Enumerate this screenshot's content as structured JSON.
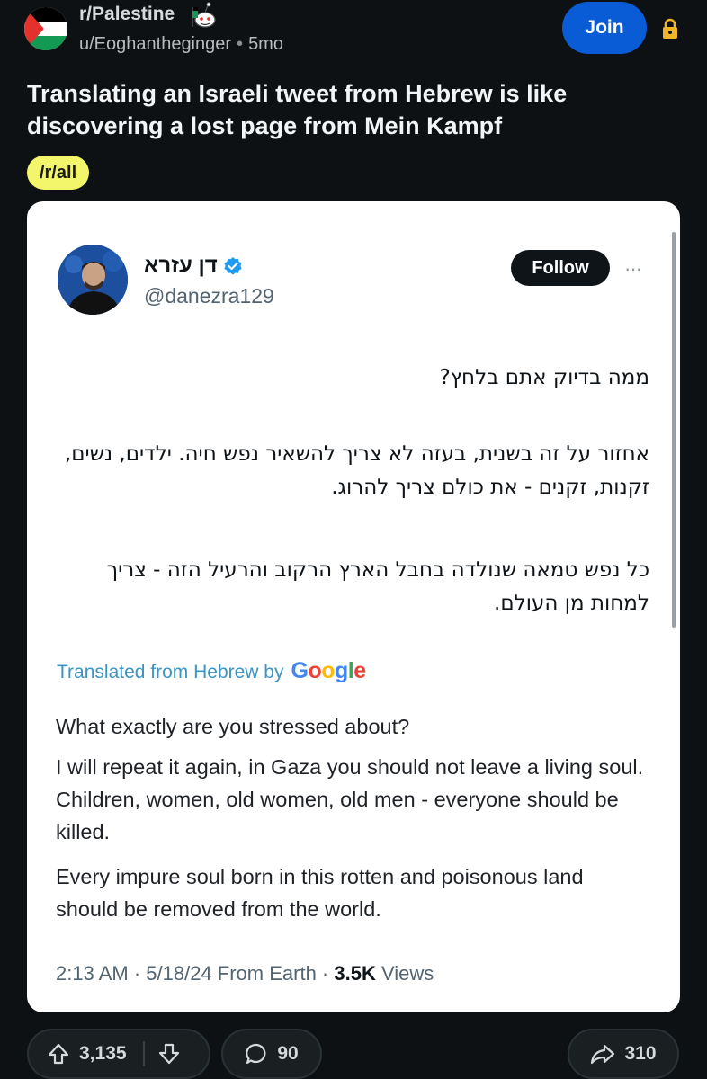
{
  "subreddit": {
    "name": "r/Palestine"
  },
  "post": {
    "author": "u/Eoghantheginger",
    "separator": "•",
    "age": "5mo",
    "title": "Translating an Israeli tweet from Hebrew is like discovering a lost page from Mein Kampf",
    "flair": "/r/all"
  },
  "header": {
    "join_label": "Join"
  },
  "tweet": {
    "display_name": "דן עזרא",
    "handle": "@danezra129",
    "follow_label": "Follow",
    "more_label": "···",
    "hebrew_lines": [
      "ממה בדיוק אתם בלחץ?",
      "אחזור על זה בשנית, בעזה לא צריך להשאיר נפש חיה. ילדים, נשים, זקנות, זקנים - את כולם צריך להרוג.",
      "כל נפש טמאה שנולדה בחבל הארץ הרקוב והרעיל הזה - צריך למחות מן העולם."
    ],
    "translated_label": "Translated from Hebrew by",
    "google_letters": [
      "G",
      "o",
      "o",
      "g",
      "l",
      "e"
    ],
    "english_lines": [
      "What exactly are you stressed about?",
      "I will repeat it again, in Gaza you should not leave a living soul. Children, women, old women, old men - everyone should be killed.",
      "Every impure soul born in this rotten and poisonous land should be removed from the world."
    ],
    "timestamp_prefix": "2:13 AM · 5/18/24 From Earth · ",
    "views_count": "3.5K",
    "views_label": " Views"
  },
  "actions": {
    "upvotes": "3,135",
    "comments": "90",
    "shares": "310"
  },
  "colors": {
    "join": "#0a5bd6",
    "flair": "#f3f56a",
    "translated": "#3a95c4",
    "verified": "#1d9bf0"
  }
}
